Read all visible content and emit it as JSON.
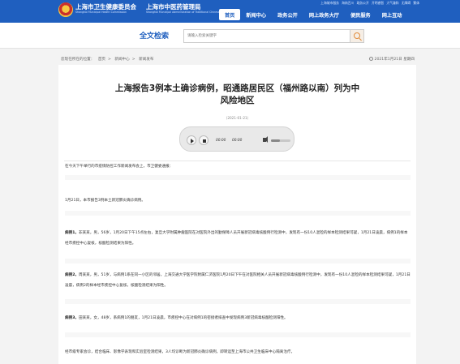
{
  "header": {
    "brand_cn_1": "上海市卫生健康委员会",
    "brand_en_1": "Shanghai Municipal Health Commission",
    "brand_cn_2": "上海市中医药管理局",
    "brand_en_2": "Shanghai Municipal Administration of Traditional Chinese Medicine",
    "top_links": [
      "上海城市服务",
      "海纳百川",
      "政务公开",
      "开明睿智",
      "大气谦和",
      "无障碍",
      "繁体"
    ],
    "nav": [
      "首页",
      "新闻中心",
      "政务公开",
      "网上政务大厅",
      "便民服务",
      "网上互动"
    ],
    "active_nav": "首页"
  },
  "search": {
    "title": "全文检索",
    "placeholder": "请输入检索关键字"
  },
  "breadcrumb": {
    "label": "您现在所在的位置：",
    "items": [
      "首页",
      "新闻中心",
      "新闻发布"
    ],
    "date": "2021年1月21日 星期四"
  },
  "article": {
    "title_line1": "上海报告3例本土确诊病例，昭通路居民区（福州路以南）列为中",
    "title_line2": "风险地区",
    "pub_date": "（2021-01-21）",
    "player": {
      "time_current": "00:00",
      "time_total": "00:00",
      "volume": 0.45
    },
    "p_intro": "在今天下午举行的市疫情防控工作新闻发布会上，市卫健委通报：",
    "p_report": "1月21日，本市报告3例本土新冠肺炎确诊病例。",
    "case1_label": "病例1，",
    "case1_text": "非某某，男，56岁，1月20日下午15点左右，复旦大学附属肿瘤医院在对医院外出的勤保障人员开展新冠病毒核酸例行检测中，发现有一份10人混检的样本检测结果可疑，1月21日凌晨，病例1的样本经市疾控中心复核，核酸检测结果为阳性。",
    "case2_label": "病例2，",
    "case2_text": "周某某，男，51岁，与病例1系在同一小区的邻居。上海交通大学医学院附属仁济医院1月20日下午在对医院相关人员开展新冠病毒核酸例行检测中，发现有一份10人混检的样本检测结果可疑，1月21日凌晨，病例2的样本经市疾控中心复核，核酸检测结果为阳性。",
    "case3_label": "病例3，",
    "case3_text": "田某某，女，48岁，系病例1的朋友，1月21日凌晨，市疾控中心在对病例1的密接者排查中发现病例3新冠病毒核酸检测阳性。",
    "p_expert": "经市级专家会诊，结合临床、影像学表现和实验室检测结果，3人均诊断为新冠肺炎确诊病例，即转运至上海市公共卫生临床中心隔离治疗。"
  }
}
